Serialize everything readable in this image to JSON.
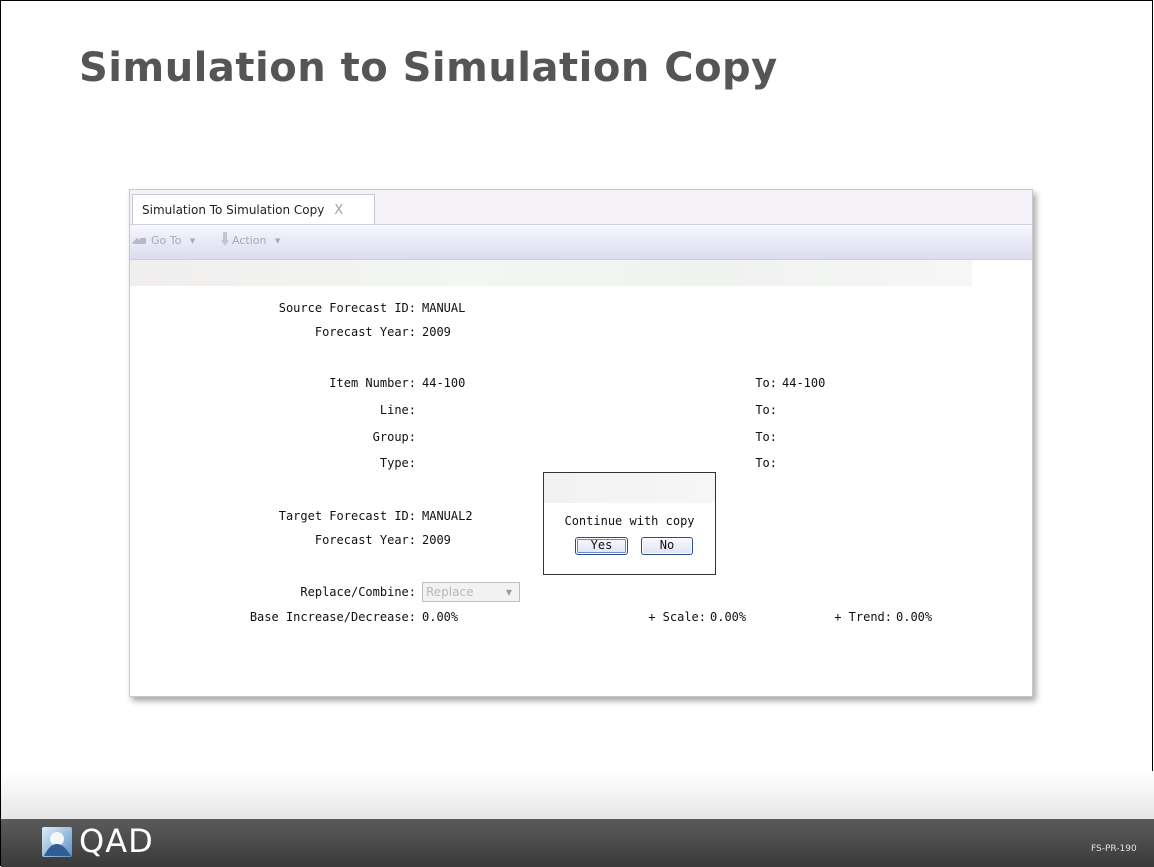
{
  "slide": {
    "title": "Simulation to Simulation Copy",
    "code": "FS-PR-190"
  },
  "tab": {
    "label": "Simulation To Simulation Copy",
    "close_glyph": "X"
  },
  "toolbar": {
    "goto_label": "Go To",
    "action_label": "Action",
    "dropdown_glyph": "▼"
  },
  "form": {
    "source_forecast_id": {
      "label": "Source Forecast ID:",
      "value": "MANUAL"
    },
    "source_forecast_year": {
      "label": "Forecast Year:",
      "value": "2009"
    },
    "item_number": {
      "label": "Item Number:",
      "value": "44-100",
      "to_label": "To:",
      "to_value": "44-100"
    },
    "line": {
      "label": "Line:",
      "value": "",
      "to_label": "To:",
      "to_value": ""
    },
    "group": {
      "label": "Group:",
      "value": "",
      "to_label": "To:",
      "to_value": ""
    },
    "type": {
      "label": "Type:",
      "value": "",
      "to_label": "To:",
      "to_value": ""
    },
    "target_forecast_id": {
      "label": "Target Forecast ID:",
      "value": "MANUAL2"
    },
    "target_forecast_year": {
      "label": "Forecast Year:",
      "value": "2009"
    },
    "replace_combine": {
      "label": "Replace/Combine:",
      "value": "Replace"
    },
    "base_increase": {
      "label": "Base Increase/Decrease:",
      "value": "0.00%"
    },
    "scale": {
      "label": "+ Scale:",
      "value": "0.00%"
    },
    "trend": {
      "label": "+ Trend:",
      "value": "0.00%"
    }
  },
  "dialog": {
    "message": "Continue with copy",
    "yes_label": "Yes",
    "no_label": "No"
  },
  "footer": {
    "logo_text": "QAD"
  },
  "icons": [
    "goto-icon",
    "action-icon",
    "close-icon",
    "chevron-down-icon",
    "qad-logo-icon"
  ],
  "colors": {
    "title": "#555555",
    "toolbar_gradient_top": "#f7f7fd",
    "toolbar_gradient_bottom": "#dcdcef",
    "dialog_button_border": "#2a4a8a",
    "footer": "#4a4a4a"
  }
}
